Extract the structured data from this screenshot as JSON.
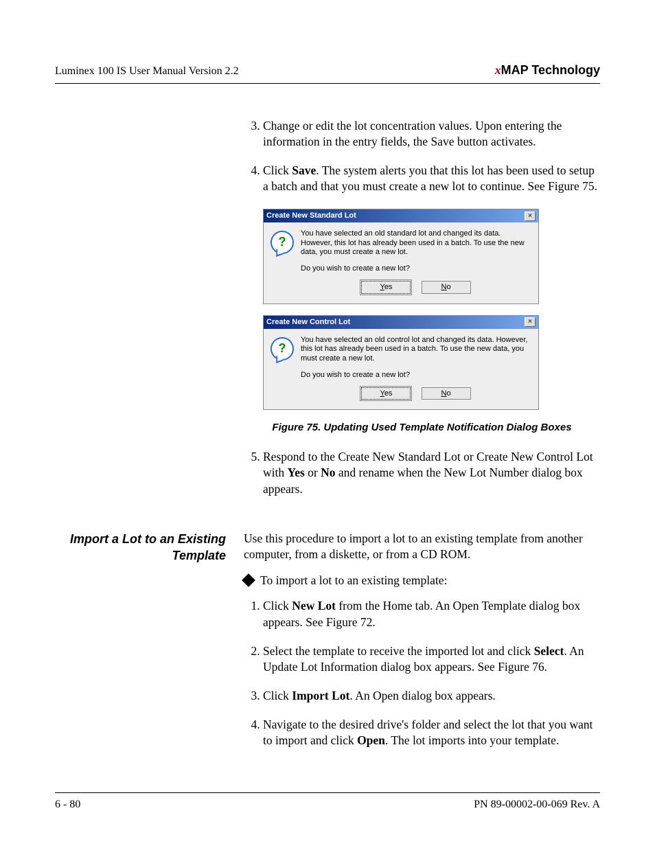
{
  "header": {
    "left": "Luminex 100 IS User Manual Version 2.2",
    "right_prefix": "x",
    "right_rest": "MAP Technology"
  },
  "steps_top": {
    "start": 3,
    "items": [
      "Change or edit the lot concentration values. Upon entering the information in the entry fields, the Save button activates.",
      {
        "pre": "Click ",
        "bold": "Save",
        "post": ". The system alerts you that this lot has been used to setup a batch and that you must create a new lot to continue. See Figure 75."
      }
    ]
  },
  "dialogs": [
    {
      "title": "Create New Standard Lot",
      "msg1": "You have selected an old standard lot and changed its data. However, this lot has already been used in a batch. To use the new data, you must create a new lot.",
      "msg2": "Do you wish to create a new lot?",
      "yes": "Yes",
      "no": "No"
    },
    {
      "title": "Create New Control Lot",
      "msg1": "You have selected an old control lot and changed its data. However, this lot has already been used in a batch. To use the new data, you must create a new lot.",
      "msg2": "Do you wish to create a new lot?",
      "yes": "Yes",
      "no": "No"
    }
  ],
  "figure_caption": "Figure 75.  Updating Used Template Notification Dialog Boxes",
  "step5": {
    "num": "5.",
    "pre": "Respond to the Create New Standard Lot or Create New Control Lot with ",
    "b1": "Yes",
    "mid": " or ",
    "b2": "No",
    "post": " and rename when the New Lot Number dialog box appears."
  },
  "section2": {
    "heading": "Import a Lot to an Existing Template",
    "intro": "Use this procedure to import a lot to an existing template from another computer, from a diskette, or from a CD ROM.",
    "bullet": "To import a lot to an existing template:",
    "steps": [
      {
        "pre": "Click ",
        "bold": "New Lot",
        "post": " from the Home tab. An Open Template dialog box appears. See Figure 72."
      },
      {
        "pre": "Select the template to receive the imported lot and click ",
        "bold": "Select",
        "post": ". An Update Lot Information dialog box appears. See Figure 76."
      },
      {
        "pre": "Click ",
        "bold": "Import Lot",
        "post": ". An Open dialog box appears."
      },
      {
        "pre": "Navigate to the desired drive's folder and select the lot that you want to import and click ",
        "bold": "Open",
        "post": ". The lot imports into your template."
      }
    ]
  },
  "footer": {
    "left": "6 - 80",
    "right": "PN 89-00002-00-069 Rev. A"
  }
}
